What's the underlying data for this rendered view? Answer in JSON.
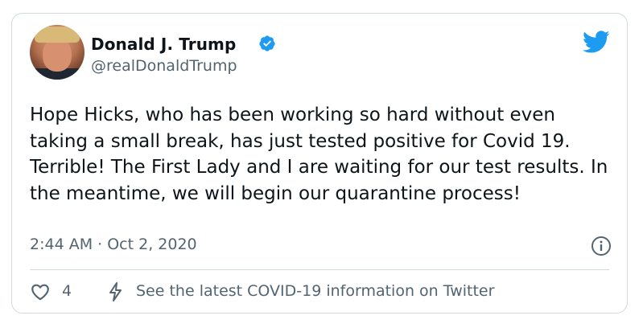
{
  "author": {
    "display_name": "Donald J. Trump",
    "handle": "@realDonaldTrump",
    "verified": true,
    "avatar_icon": "profile-photo"
  },
  "tweet": {
    "text": "Hope Hicks, who has been working so hard without even taking a small break, has just tested positive for Covid 19. Terrible! The First Lady and I are waiting for our test results. In the meantime, we will begin our quarantine process!",
    "timestamp": "2:44 AM · Oct 2, 2020"
  },
  "actions": {
    "like_count": "4",
    "covid_info": "See the latest COVID-19 information on Twitter"
  },
  "colors": {
    "brand_blue": "#1d9bf0",
    "text_primary": "#0f1419",
    "text_secondary": "#536471",
    "border": "#cfd9de"
  },
  "icons": [
    "verified-badge-icon",
    "twitter-bird-icon",
    "info-icon",
    "heart-icon",
    "lightning-bolt-icon"
  ]
}
